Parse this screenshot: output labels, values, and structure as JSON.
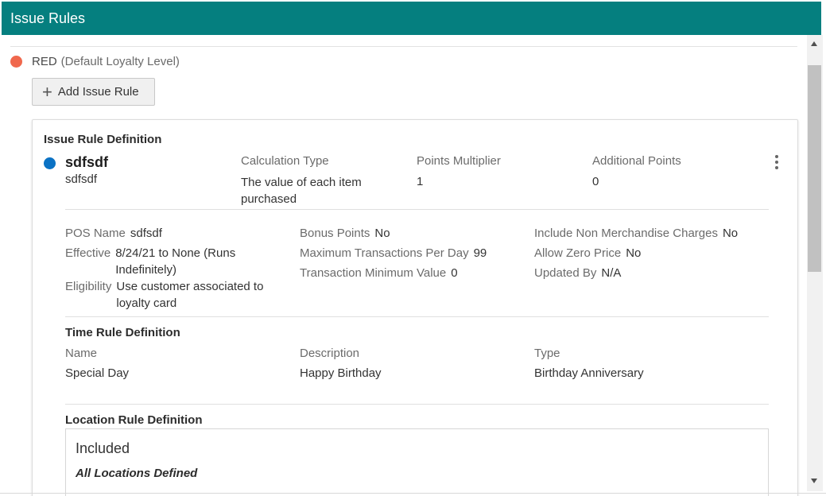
{
  "header": {
    "title": "Issue Rules"
  },
  "loyalty_level": {
    "name": "RED",
    "note": "(Default Loyalty Level)",
    "color": "#f0684d"
  },
  "add_button": {
    "label": "Add Issue Rule"
  },
  "rule": {
    "section_title": "Issue Rule Definition",
    "name": "sdfsdf",
    "subtitle": "sdfsdf",
    "dot_color": "#0b72c4",
    "columns": {
      "calculation_type": {
        "label": "Calculation Type",
        "value_line1": "The value of each item",
        "value_line2": "purchased"
      },
      "points_multiplier": {
        "label": "Points Multiplier",
        "value": "1"
      },
      "additional_points": {
        "label": "Additional Points",
        "value": "0"
      }
    },
    "details": {
      "pos_name": {
        "label": "POS Name",
        "value": "sdfsdf"
      },
      "effective": {
        "label": "Effective",
        "value_line1": "8/24/21 to None (Runs",
        "value_line2": "Indefinitely)"
      },
      "eligibility": {
        "label": "Eligibility",
        "value_line1": "Use customer associated to",
        "value_line2": "loyalty card"
      },
      "bonus_points": {
        "label": "Bonus Points",
        "value": "No"
      },
      "max_transactions": {
        "label": "Maximum Transactions Per Day",
        "value": "99"
      },
      "transaction_min": {
        "label": "Transaction Minimum Value",
        "value": "0"
      },
      "include_non_merch": {
        "label": "Include Non Merchandise Charges",
        "value": "No"
      },
      "allow_zero_price": {
        "label": "Allow Zero Price",
        "value": "No"
      },
      "updated_by": {
        "label": "Updated By",
        "value": "N/A"
      }
    }
  },
  "time_rule": {
    "title": "Time Rule Definition",
    "name_label": "Name",
    "name_value": "Special Day",
    "description_label": "Description",
    "description_value": "Happy Birthday",
    "type_label": "Type",
    "type_value": "Birthday Anniversary"
  },
  "location_rule": {
    "title": "Location Rule Definition",
    "included_label": "Included",
    "all_locations": "All Locations Defined"
  }
}
